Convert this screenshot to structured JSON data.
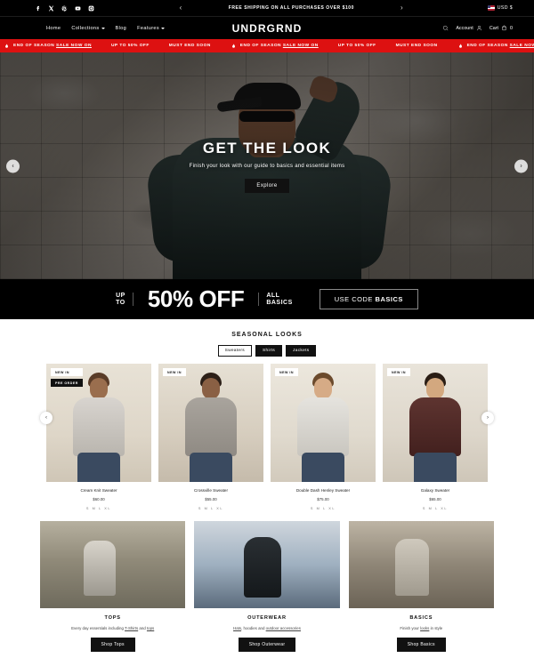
{
  "topbar": {
    "social": [
      {
        "name": "facebook-icon",
        "label": "Facebook"
      },
      {
        "name": "x-twitter-icon",
        "label": "X"
      },
      {
        "name": "pinterest-icon",
        "label": "Pinterest"
      },
      {
        "name": "youtube-icon",
        "label": "YouTube"
      },
      {
        "name": "instagram-icon",
        "label": "Instagram"
      }
    ],
    "prev_label": "‹",
    "next_label": "›",
    "announcement": "FREE SHIPPING ON ALL PURCHASES OVER $100",
    "currency": "USD $"
  },
  "header": {
    "nav": [
      {
        "label": "Home",
        "caret": false
      },
      {
        "label": "Collections",
        "caret": true
      },
      {
        "label": "Blog",
        "caret": false
      },
      {
        "label": "Features",
        "caret": true
      }
    ],
    "logo": "UNDRGRND",
    "search_label": "",
    "account_label": "Account",
    "cart_label": "Cart",
    "cart_count": "0"
  },
  "marquee": {
    "items": [
      {
        "text": "END OF SEASON ",
        "underlined": "SALE NOW ON",
        "fire": true
      },
      {
        "text": "UP TO 50% OFF",
        "underlined": "",
        "fire": false
      },
      {
        "text": "MUST END SOON",
        "underlined": "",
        "fire": false
      }
    ],
    "repeat": 4
  },
  "hero": {
    "title": "GET THE LOOK",
    "subtitle": "Finish your look with our guide to basics and essential items",
    "button": "Explore",
    "prev": "‹",
    "next": "›"
  },
  "promo": {
    "up_to": "UP\nTO",
    "discount": "50% OFF",
    "all_basics": "ALL\nBASICS",
    "code_prefix": "USE CODE ",
    "code": "BASICS"
  },
  "seasonal": {
    "title": "SEASONAL LOOKS",
    "tabs": [
      {
        "label": "Sweaters",
        "active": true
      },
      {
        "label": "Shirts",
        "active": false
      },
      {
        "label": "Jackets",
        "active": false
      }
    ],
    "prev": "‹",
    "next": "›",
    "products": [
      {
        "name": "Cream Knit Sweater",
        "price": "$60.00",
        "sizes": "S M L XL",
        "badges": [
          "NEW IN",
          "PRE ORDER"
        ]
      },
      {
        "name": "Crossville Sweater",
        "price": "$55.00",
        "sizes": "S M L XL",
        "badges": [
          "NEW IN"
        ]
      },
      {
        "name": "Double Dash Henley Sweater",
        "price": "$75.00",
        "sizes": "S M L XL",
        "badges": [
          "NEW IN"
        ]
      },
      {
        "name": "Galaxy Sweater",
        "price": "$65.00",
        "sizes": "S M L XL",
        "badges": [
          "NEW IN"
        ]
      }
    ]
  },
  "categories": [
    {
      "title": "TOPS",
      "desc_before": "Every day essentials including ",
      "link1": "T-Shirts",
      "desc_mid": " and ",
      "link2": "tops",
      "desc_after": "",
      "button": "Shop Tops"
    },
    {
      "title": "OUTERWEAR",
      "desc_before": "",
      "link1": "Hats",
      "desc_mid": ", hoodies and ",
      "link2": "outdoor accessories",
      "desc_after": "",
      "button": "Shop Outerwear"
    },
    {
      "title": "BASICS",
      "desc_before": "Finish your ",
      "link1": "looks",
      "desc_mid": " in style",
      "link2": "",
      "desc_after": "",
      "button": "Shop Basics"
    }
  ],
  "colors": {
    "sale_red": "#dd1111",
    "black": "#000000",
    "white": "#ffffff"
  }
}
